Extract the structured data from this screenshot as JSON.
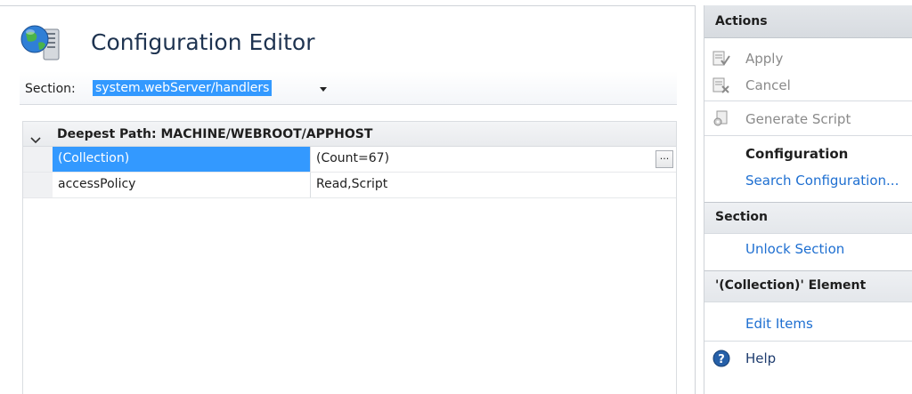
{
  "editor": {
    "title": "Configuration Editor",
    "section_label": "Section:",
    "section_value": "system.webServer/handlers"
  },
  "grid": {
    "header": "Deepest Path: MACHINE/WEBROOT/APPHOST",
    "rows": [
      {
        "name": "(Collection)",
        "value": "(Count=67)",
        "button": "..."
      },
      {
        "name": "accessPolicy",
        "value": "Read,Script"
      }
    ]
  },
  "actions": {
    "header": "Actions",
    "apply": "Apply",
    "cancel": "Cancel",
    "generate_script": "Generate Script",
    "configuration": "Configuration",
    "search_configuration": "Search Configuration...",
    "section_title": "Section",
    "unlock_section": "Unlock Section",
    "element_title": "'(Collection)' Element",
    "edit_items": "Edit Items",
    "help": "Help"
  },
  "colors": {
    "selection": "#3399ff",
    "link": "#1e6fd1",
    "disabled": "#8a8a8a"
  },
  "icons": [
    "globe-server-icon",
    "chevron-down-icon",
    "collapse-arrow-icon",
    "apply-icon",
    "cancel-icon",
    "script-icon",
    "help-icon"
  ]
}
